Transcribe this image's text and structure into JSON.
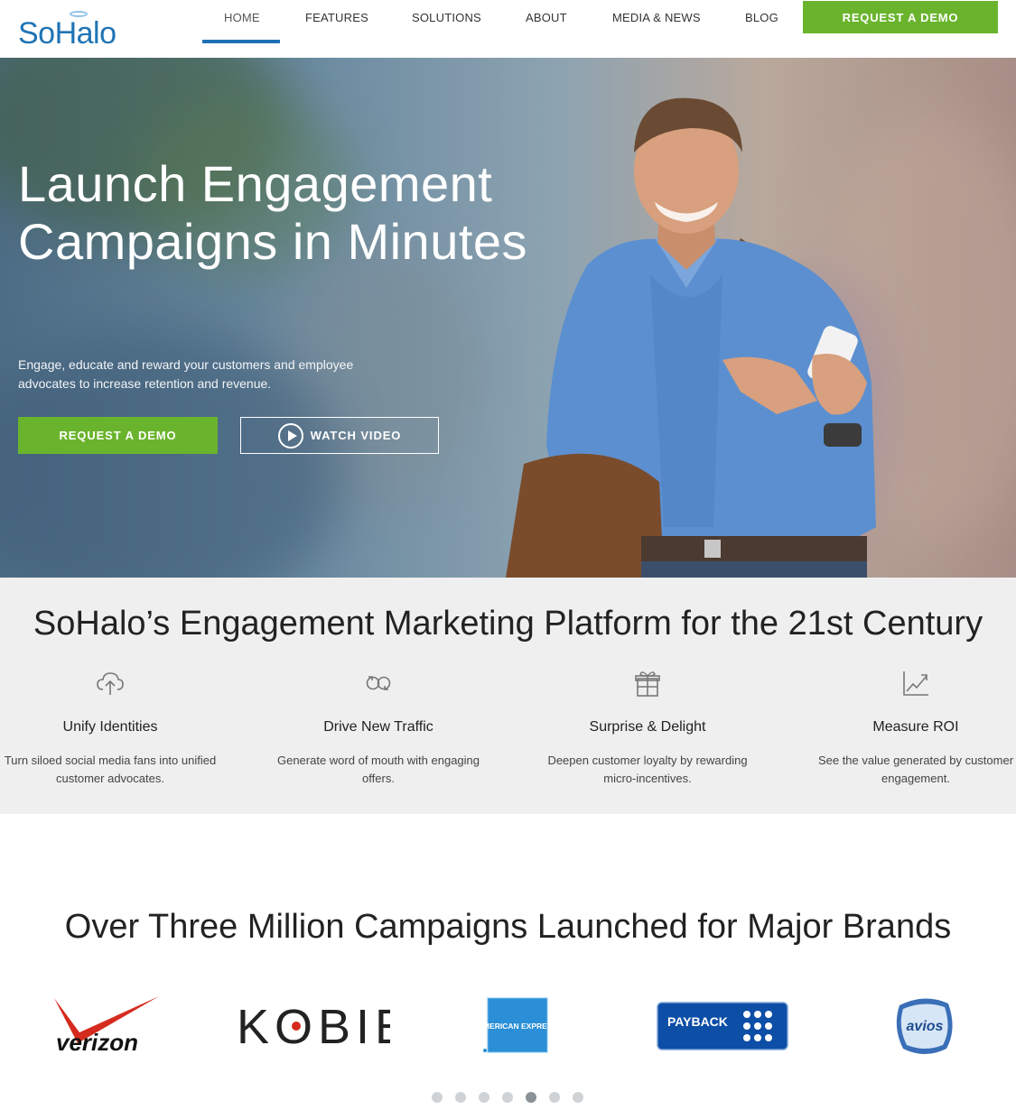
{
  "nav": {
    "logo": "SoHalo",
    "items": [
      {
        "label": "HOME",
        "active": true
      },
      {
        "label": "FEATURES"
      },
      {
        "label": "SOLUTIONS"
      },
      {
        "label": "ABOUT"
      },
      {
        "label": "MEDIA & NEWS"
      },
      {
        "label": "BLOG"
      }
    ],
    "cta": "REQUEST A DEMO"
  },
  "hero": {
    "title": "Launch Engagement Campaigns in Minutes",
    "subtitle": "Engage, educate and reward your customers and employee advocates to increase retention and revenue.",
    "demo_button": "REQUEST A DEMO",
    "video_button": "WATCH VIDEO"
  },
  "features": {
    "title": "SoHalo’s Engagement Marketing Platform for the 21st Century",
    "items": [
      {
        "icon": "cloud-upload-icon",
        "title": "Unify Identities",
        "desc": "Turn siloed social media fans into unified customer advocates."
      },
      {
        "icon": "infinity-refresh-icon",
        "title": "Drive New Traffic",
        "desc": "Generate word of mouth with engaging offers."
      },
      {
        "icon": "gift-icon",
        "title": "Surprise & Delight",
        "desc": "Deepen customer loyalty by rewarding micro-incentives."
      },
      {
        "icon": "growth-chart-icon",
        "title": "Measure ROI",
        "desc": "See the value generated by customer engagement."
      }
    ]
  },
  "brands": {
    "title": "Over Three Million Campaigns Launched for Major Brands",
    "logos": [
      "verizon",
      "KOBIE",
      "AMERICAN EXPRESS",
      "PAYBACK",
      "avios"
    ],
    "carousel": {
      "count": 7,
      "active_index": 4
    }
  },
  "colors": {
    "brand_blue": "#1f74b5",
    "accent_green": "#6ab42d",
    "nav_underline": "#1f6fb5",
    "features_bg": "#efefef"
  }
}
